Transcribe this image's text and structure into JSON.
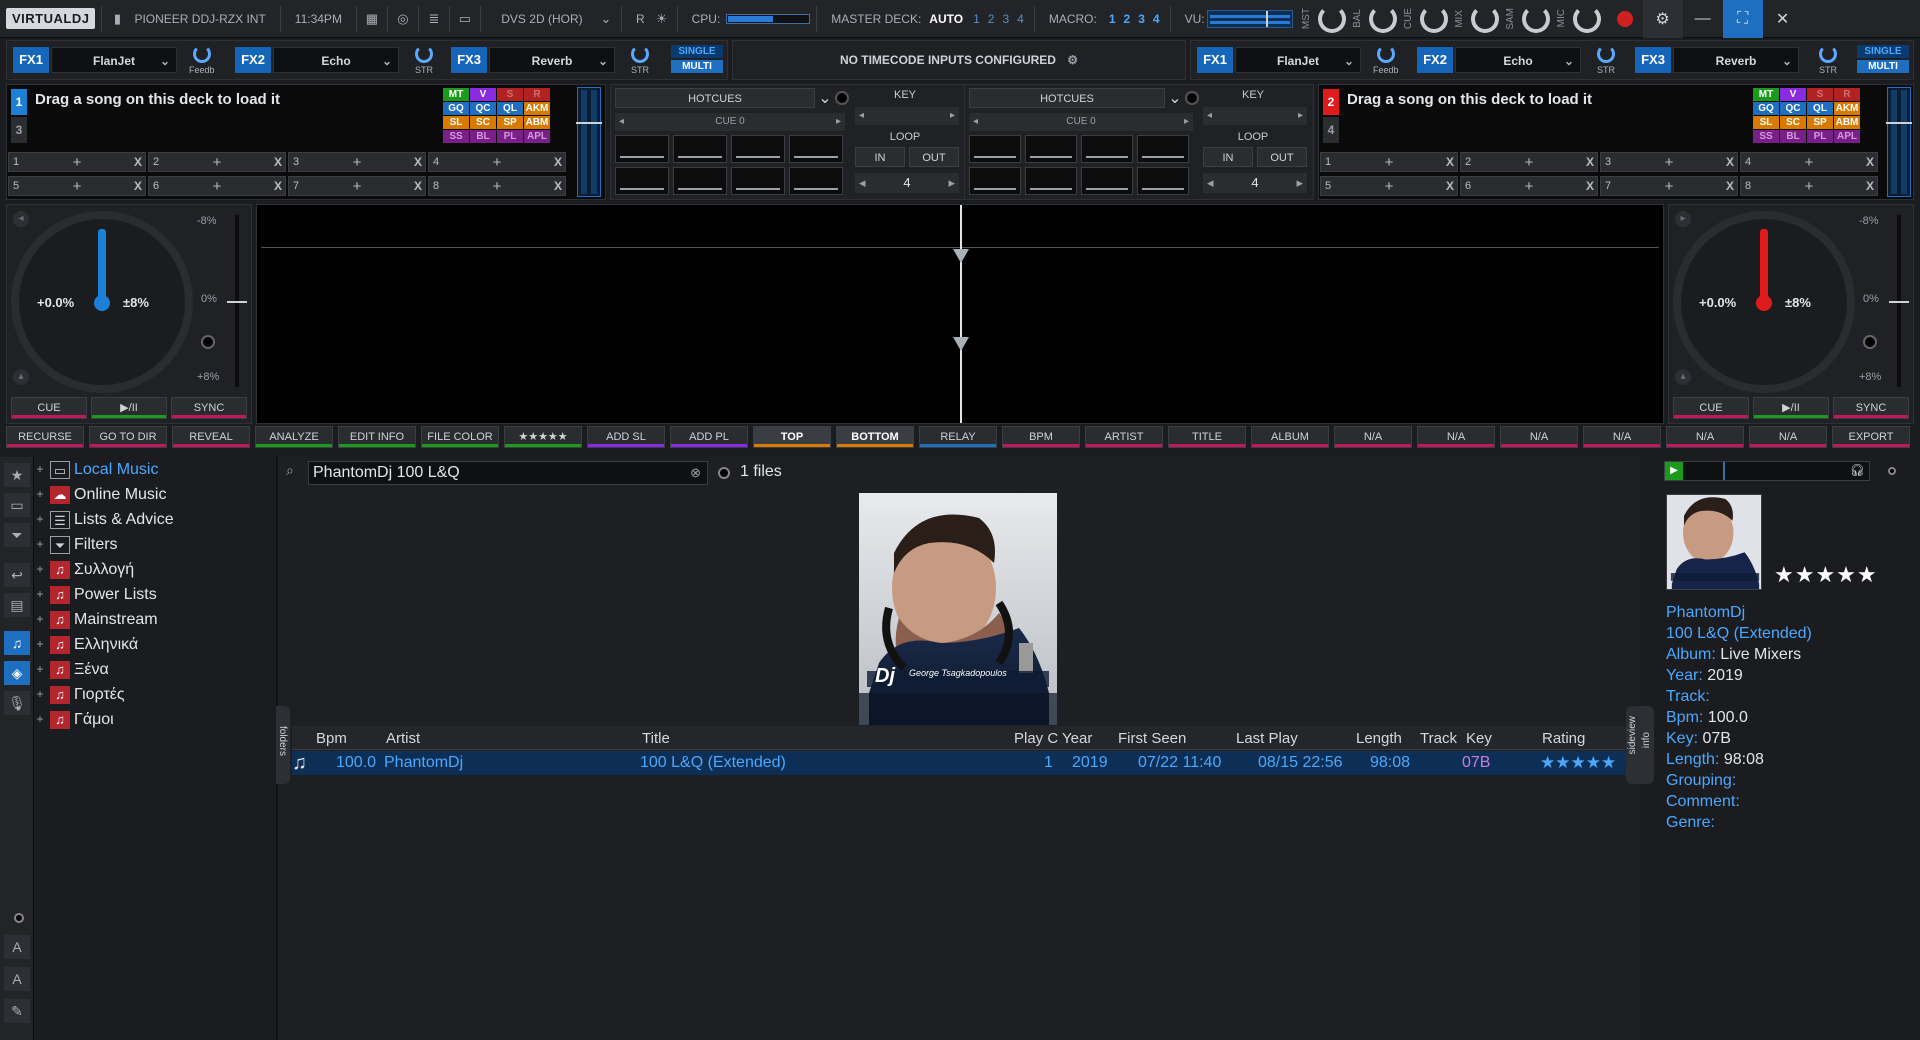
{
  "titlebar": {
    "logo": "VIRTUALDJ",
    "controller": "PIONEER DDJ-RZX INT",
    "time": "11:34PM",
    "layout": "DVS 2D (HOR)",
    "rec_label": "R",
    "cpu_label": "CPU:",
    "cpu_level_percent": 55,
    "master_deck_label": "MASTER DECK:",
    "master_deck_value": "AUTO",
    "master_deck_options": [
      "1",
      "2",
      "3",
      "4"
    ],
    "macro_label": "MACRO:",
    "macro_options": [
      "1",
      "2",
      "3",
      "4"
    ],
    "vu_label": "VU:",
    "knob_labels": [
      "MST",
      "BAL",
      "CUE",
      "MIX",
      "SAM",
      "MIC"
    ],
    "icons": [
      "calendar-icon",
      "broadcast-icon",
      "database-icon",
      "monitor-icon",
      "brightness-icon",
      "record-icon",
      "gear-icon",
      "minimize-icon",
      "maximize-icon",
      "close-icon"
    ]
  },
  "fx_left": {
    "slots": [
      {
        "label": "FX1",
        "effect": "FlanJet",
        "knob": "Feedb"
      },
      {
        "label": "FX2",
        "effect": "Echo",
        "knob": "STR"
      },
      {
        "label": "FX3",
        "effect": "Reverb",
        "knob": "STR"
      }
    ],
    "single": "SINGLE",
    "multi": "MULTI"
  },
  "fx_right": {
    "slots": [
      {
        "label": "FX1",
        "effect": "FlanJet",
        "knob": "Feedb"
      },
      {
        "label": "FX2",
        "effect": "Echo",
        "knob": "STR"
      },
      {
        "label": "FX3",
        "effect": "Reverb",
        "knob": "STR"
      }
    ],
    "single": "SINGLE",
    "multi": "MULTI"
  },
  "timecode_message": "NO TIMECODE INPUTS CONFIGURED",
  "deck1": {
    "number": "1",
    "alt_number": "3",
    "message": "Drag a song on this deck to load it",
    "pitch": "+0.0%",
    "range": "±8%",
    "pitch_top": "-8%",
    "pitch_mid": "0%",
    "pitch_bottom": "+8%",
    "cue": "CUE",
    "play": "▶/II",
    "sync": "SYNC",
    "color": "#1e7fd6"
  },
  "deck2": {
    "number": "2",
    "alt_number": "4",
    "message": "Drag a song on this deck to load it",
    "pitch": "+0.0%",
    "range": "±8%",
    "pitch_top": "-8%",
    "pitch_mid": "0%",
    "pitch_bottom": "+8%",
    "cue": "CUE",
    "play": "▶/II",
    "sync": "SYNC",
    "color": "#e01b1b"
  },
  "keygrid": [
    {
      "t": "MT",
      "bg": "#1c9a1c",
      "fg": "#fff"
    },
    {
      "t": "V",
      "bg": "#8a2be2",
      "fg": "#fff"
    },
    {
      "t": "S",
      "bg": "#b22222",
      "fg": "#d07070"
    },
    {
      "t": "R",
      "bg": "#b22222",
      "fg": "#d07070"
    },
    {
      "t": "GQ",
      "bg": "#1e6fc0",
      "fg": "#fff"
    },
    {
      "t": "QC",
      "bg": "#1e6fc0",
      "fg": "#fff"
    },
    {
      "t": "QL",
      "bg": "#1e6fc0",
      "fg": "#fff"
    },
    {
      "t": "AKM",
      "bg": "#d97a00",
      "fg": "#fff"
    },
    {
      "t": "SL",
      "bg": "#d97a00",
      "fg": "#fff"
    },
    {
      "t": "SC",
      "bg": "#d97a00",
      "fg": "#fff"
    },
    {
      "t": "SP",
      "bg": "#d97a00",
      "fg": "#fff"
    },
    {
      "t": "ABM",
      "bg": "#d97a00",
      "fg": "#fff"
    },
    {
      "t": "SS",
      "bg": "#7a1f8a",
      "fg": "#d49ade"
    },
    {
      "t": "BL",
      "bg": "#7a1f8a",
      "fg": "#d49ade"
    },
    {
      "t": "PL",
      "bg": "#7a1f8a",
      "fg": "#d49ade"
    },
    {
      "t": "APL",
      "bg": "#7a1f8a",
      "fg": "#d49ade"
    }
  ],
  "pads": {
    "row1": [
      "1",
      "2",
      "3",
      "4"
    ],
    "row2": [
      "5",
      "6",
      "7",
      "8"
    ],
    "plus": "+",
    "x": "X"
  },
  "hotcues": {
    "label": "HOTCUES",
    "cue": "CUE 0",
    "key": "KEY",
    "loop": "LOOP",
    "in": "IN",
    "out": "OUT",
    "loop_value": "4"
  },
  "toolbar": {
    "buttons": [
      {
        "t": "RECURSE",
        "c": "#c0185e"
      },
      {
        "t": "GO TO DIR",
        "c": "#c0185e"
      },
      {
        "t": "REVEAL",
        "c": "#c0185e"
      },
      {
        "t": "ANALYZE",
        "c": "#1c9a1c"
      },
      {
        "t": "EDIT INFO",
        "c": "#1c9a1c"
      },
      {
        "t": "FILE COLOR",
        "c": "#1c9a1c"
      },
      {
        "t": "★★★★★",
        "c": "#1c9a1c"
      },
      {
        "t": "ADD SL",
        "c": "#8a2be2"
      },
      {
        "t": "ADD PL",
        "c": "#8a2be2"
      },
      {
        "t": "TOP",
        "c": "#d97a00"
      },
      {
        "t": "BOTTOM",
        "c": "#d97a00"
      },
      {
        "t": "RELAY",
        "c": "#1e6fc0"
      },
      {
        "t": "BPM",
        "c": "#c0185e"
      },
      {
        "t": "ARTIST",
        "c": "#c0185e"
      },
      {
        "t": "TITLE",
        "c": "#c0185e"
      },
      {
        "t": "ALBUM",
        "c": "#c0185e"
      },
      {
        "t": "N/A",
        "c": "#c0185e"
      },
      {
        "t": "N/A",
        "c": "#c0185e"
      },
      {
        "t": "N/A",
        "c": "#c0185e"
      },
      {
        "t": "N/A",
        "c": "#c0185e"
      },
      {
        "t": "N/A",
        "c": "#c0185e"
      },
      {
        "t": "N/A",
        "c": "#c0185e"
      },
      {
        "t": "EXPORT",
        "c": "#c0185e"
      }
    ]
  },
  "tree": [
    {
      "label": "Local Music",
      "icon": "computer-icon",
      "selected": true
    },
    {
      "label": "Online Music",
      "icon": "cloud-icon",
      "selected": false
    },
    {
      "label": "Lists & Advice",
      "icon": "list-icon",
      "selected": false
    },
    {
      "label": "Filters",
      "icon": "filter-icon",
      "selected": false
    },
    {
      "label": "Συλλογή",
      "icon": "folder-icon",
      "selected": false
    },
    {
      "label": "Power Lists",
      "icon": "folder-icon",
      "selected": false
    },
    {
      "label": "Mainstream",
      "icon": "folder-icon",
      "selected": false
    },
    {
      "label": "Ελληνικά",
      "icon": "folder-icon",
      "selected": false
    },
    {
      "label": "Ξένα",
      "icon": "folder-icon",
      "selected": false
    },
    {
      "label": "Γιορτές",
      "icon": "folder-icon",
      "selected": false
    },
    {
      "label": "Γάμοι",
      "icon": "folder-icon",
      "selected": false
    }
  ],
  "search": {
    "value": "PhantomDj 100 L&Q",
    "count": "1 files"
  },
  "side_tabs": {
    "folders": "folders",
    "sideview": "sideview",
    "info": "info"
  },
  "table": {
    "headers": [
      "Bpm",
      "Artist",
      "Title",
      "Play C",
      "Year",
      "First Seen",
      "Last Play",
      "Length",
      "Track",
      "Key",
      "Rating"
    ],
    "rows": [
      {
        "bpm": "100.0",
        "artist": "PhantomDj",
        "title": "100 L&Q (Extended)",
        "play": "1",
        "year": "2019",
        "first_seen": "07/22 11:40",
        "last_play": "08/15 22:56",
        "length": "98:08",
        "track": "",
        "key": "07B",
        "rating": "★★★★★"
      }
    ]
  },
  "info": {
    "stars": "★★★★★",
    "artist": "PhantomDj",
    "title": "100 L&Q (Extended)",
    "album_label": "Album:",
    "album": "Live Mixers",
    "year_label": "Year:",
    "year": "2019",
    "track_label": "Track:",
    "bpm_label": "Bpm:",
    "bpm": "100.0",
    "key_label": "Key:",
    "key": "07B",
    "length_label": "Length:",
    "length": "98:08",
    "grouping_label": "Grouping:",
    "comment_label": "Comment:",
    "genre_label": "Genre:"
  },
  "cover_text": "George Tsagkadopoulos",
  "left_tools": [
    "A",
    "A",
    "edit"
  ]
}
